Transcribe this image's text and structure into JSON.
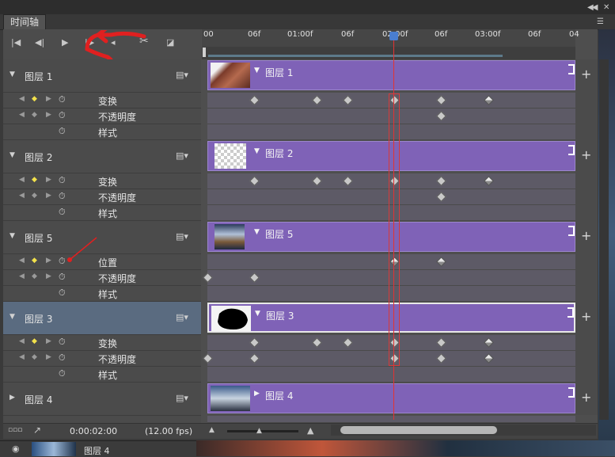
{
  "panel": {
    "tab_label": "时间轴",
    "collapse_icon": "double-chevron-icon",
    "menu_icon": "panel-menu-icon"
  },
  "controls": [
    "first-frame-icon",
    "prev-frame-icon",
    "play-icon",
    "next-frame-icon",
    "audio-icon",
    "split-icon",
    "transition-icon"
  ],
  "ruler": {
    "ticks": [
      "00",
      "06f",
      "01:00f",
      "06f",
      "02:00f",
      "06f",
      "03:00f",
      "06f",
      "04"
    ]
  },
  "layers": [
    {
      "name": "图层 1",
      "expanded": true,
      "selected": false,
      "props": [
        {
          "name": "变换"
        },
        {
          "name": "不透明度"
        },
        {
          "name": "样式"
        }
      ]
    },
    {
      "name": "图层 2",
      "expanded": true,
      "selected": false,
      "props": [
        {
          "name": "变换"
        },
        {
          "name": "不透明度"
        },
        {
          "name": "样式"
        }
      ]
    },
    {
      "name": "图层 5",
      "expanded": true,
      "selected": false,
      "props": [
        {
          "name": "位置"
        },
        {
          "name": "不透明度"
        },
        {
          "name": "样式"
        }
      ]
    },
    {
      "name": "图层 3",
      "expanded": true,
      "selected": true,
      "props": [
        {
          "name": "变换"
        },
        {
          "name": "不透明度"
        },
        {
          "name": "样式"
        }
      ]
    },
    {
      "name": "图层 4",
      "expanded": false,
      "selected": false,
      "props": []
    }
  ],
  "bottom": {
    "timecode": "0:00:02:00",
    "fps": "(12.00 fps)"
  },
  "layers_panel": {
    "label": "图层 4"
  },
  "colors": {
    "clip": "#7f62b7",
    "playhead": "#e23333",
    "keyframe_control": "#f2e14b"
  }
}
